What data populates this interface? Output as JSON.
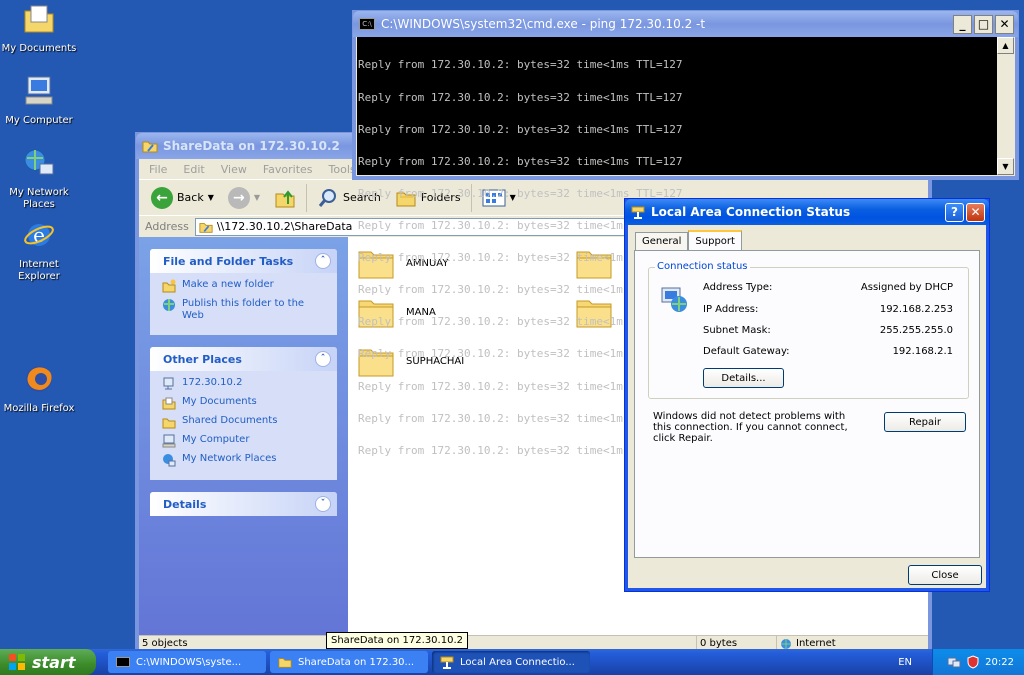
{
  "desktop": {
    "icons": [
      {
        "label": "My Documents",
        "icon": "my-documents-icon"
      },
      {
        "label": "My Computer",
        "icon": "my-computer-icon"
      },
      {
        "label": "My Network Places",
        "icon": "network-places-icon"
      },
      {
        "label": "Internet Explorer",
        "icon": "internet-explorer-icon"
      },
      {
        "label": "Mozilla Firefox",
        "icon": "firefox-icon"
      }
    ]
  },
  "cmd": {
    "title": "C:\\WINDOWS\\system32\\cmd.exe - ping 172.30.10.2 -t",
    "lines": [
      "Reply from 172.30.10.2: bytes=32 time<1ms TTL=127",
      "Reply from 172.30.10.2: bytes=32 time<1ms TTL=127",
      "Reply from 172.30.10.2: bytes=32 time<1ms TTL=127",
      "Reply from 172.30.10.2: bytes=32 time<1ms TTL=127",
      "Reply from 172.30.10.2: bytes=32 time<1ms TTL=127",
      "Reply from 172.30.10.2: bytes=32 time<1ms TTL=127",
      "Reply from 172.30.10.2: bytes=32 time<1ms TTL=127",
      "Reply from 172.30.10.2: bytes=32 time<1ms TTL=127",
      "Reply from 172.30.10.2: bytes=32 time<1ms TTL=127",
      "Reply from 172.30.10.2: bytes=32 time<1ms TTL=127",
      "Reply from 172.30.10.2: bytes=32 time<1ms TTL=127",
      "Reply from 172.30.10.2: bytes=32 time<1ms TTL=127",
      "Reply from 172.30.10.2: bytes=32 time<1ms TTL=127"
    ]
  },
  "explorer": {
    "title": "ShareData on 172.30.10.2",
    "menu": [
      "File",
      "Edit",
      "View",
      "Favorites",
      "Tools"
    ],
    "toolbar": {
      "back": "Back",
      "search": "Search",
      "folders": "Folders"
    },
    "address_label": "Address",
    "address_value": "\\\\172.30.10.2\\ShareData",
    "file_tasks": {
      "title": "File and Folder Tasks",
      "links": [
        "Make a new folder",
        "Publish this folder to the Web"
      ]
    },
    "other_places": {
      "title": "Other Places",
      "links": [
        "172.30.10.2",
        "My Documents",
        "Shared Documents",
        "My Computer",
        "My Network Places"
      ]
    },
    "details": {
      "title": "Details"
    },
    "folders": [
      "AMNUAY",
      "MANA",
      "SUPHACHAI"
    ],
    "status": {
      "objects": "5 objects",
      "size": "0 bytes",
      "zone": "Internet"
    }
  },
  "tooltip": "ShareData on 172.30.10.2",
  "lan": {
    "title": "Local Area Connection Status",
    "tabs": [
      "General",
      "Support"
    ],
    "group_title": "Connection status",
    "fields": [
      {
        "label": "Address Type:",
        "value": "Assigned by DHCP"
      },
      {
        "label": "IP Address:",
        "value": "192.168.2.253"
      },
      {
        "label": "Subnet Mask:",
        "value": "255.255.255.0"
      },
      {
        "label": "Default Gateway:",
        "value": "192.168.2.1"
      }
    ],
    "details_button": "Details...",
    "message": "Windows did not detect problems with this connection. If you cannot connect, click Repair.",
    "repair_button": "Repair",
    "close_button": "Close"
  },
  "taskbar": {
    "start": "start",
    "tasks": [
      "C:\\WINDOWS\\syste...",
      "ShareData on 172.30...",
      "Local Area Connectio..."
    ],
    "language": "EN",
    "clock": "20:22"
  },
  "colors": {
    "desktop": "#2459b3",
    "title_active": "#0053e1",
    "taskpane_link": "#215dc6"
  }
}
